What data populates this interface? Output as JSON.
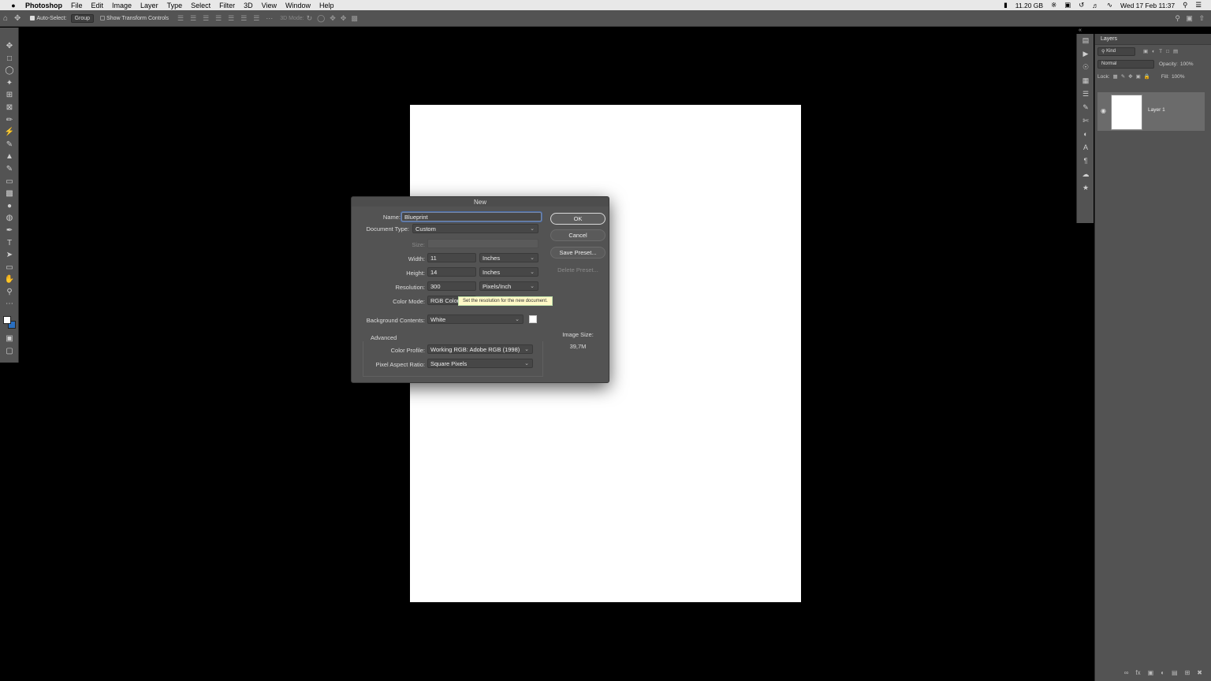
{
  "menubar": {
    "apple": "",
    "app": "Photoshop",
    "items": [
      "File",
      "Edit",
      "Image",
      "Layer",
      "Type",
      "Select",
      "Filter",
      "3D",
      "View",
      "Window",
      "Help"
    ],
    "status": {
      "storage": "11.20 GB",
      "datetime": "Wed 17 Feb  11:37"
    }
  },
  "options": {
    "auto_select_label": "Auto-Select:",
    "auto_select_value": "Group",
    "transform_label": "Show Transform Controls",
    "mode3d_label": "3D Mode:"
  },
  "tools": [
    "move-tool",
    "marquee-tool",
    "lasso-tool",
    "magic-wand-tool",
    "crop-tool",
    "frame-tool",
    "eyedropper-tool",
    "healing-brush-tool",
    "brush-tool",
    "clone-stamp-tool",
    "history-brush-tool",
    "eraser-tool",
    "gradient-tool",
    "blur-tool",
    "dodge-tool",
    "pen-tool",
    "type-tool",
    "path-selection-tool",
    "rectangle-tool",
    "hand-tool",
    "zoom-tool",
    "more-tools"
  ],
  "layers_panel": {
    "title": "Layers",
    "filter_label": "Kind",
    "blend_mode": "Normal",
    "opacity_label": "Opacity:",
    "opacity_value": "100%",
    "lock_label": "Lock:",
    "fill_label": "Fill:",
    "fill_value": "100%",
    "layer_name": "Layer 1"
  },
  "dialog": {
    "title": "New",
    "name_label": "Name:",
    "name_value": "Blueprint",
    "doctype_label": "Document Type:",
    "doctype_value": "Custom",
    "size_label": "Size:",
    "width_label": "Width:",
    "width_value": "11",
    "width_unit": "Inches",
    "height_label": "Height:",
    "height_value": "14",
    "height_unit": "Inches",
    "resolution_label": "Resolution:",
    "resolution_value": "300",
    "resolution_unit": "Pixels/Inch",
    "colormode_label": "Color Mode:",
    "colormode_value": "RGB Color",
    "bg_label": "Background Contents:",
    "bg_value": "White",
    "advanced_label": "Advanced",
    "profile_label": "Color Profile:",
    "profile_value": "Working RGB:  Adobe RGB (1998)",
    "aspect_label": "Pixel Aspect Ratio:",
    "aspect_value": "Square Pixels",
    "ok": "OK",
    "cancel": "Cancel",
    "save_preset": "Save Preset...",
    "delete_preset": "Delete Preset...",
    "image_size_label": "Image Size:",
    "image_size_value": "39,7M",
    "tooltip": "Set the resolution for the new document."
  }
}
